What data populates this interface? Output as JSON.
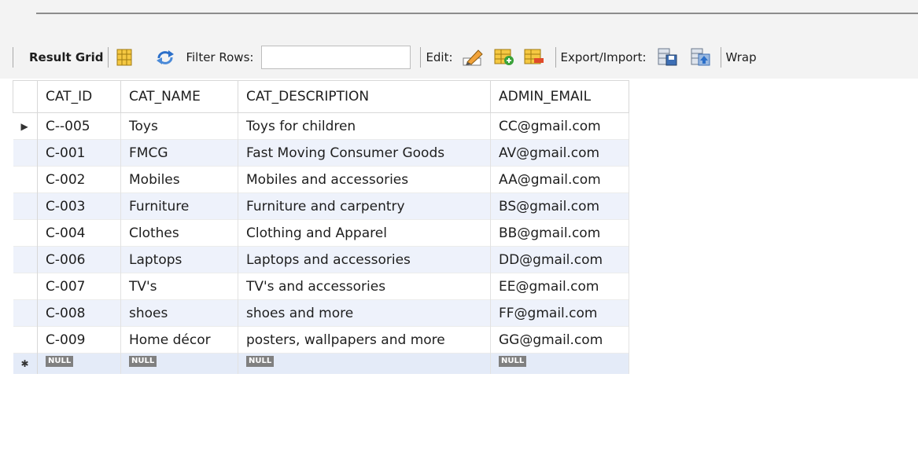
{
  "toolbar": {
    "result_grid_label": "Result Grid",
    "filter_label": "Filter Rows:",
    "filter_value": "",
    "edit_label": "Edit:",
    "export_label": "Export/Import:",
    "wrap_label": "Wrap"
  },
  "grid": {
    "columns": [
      "CAT_ID",
      "CAT_NAME",
      "CAT_DESCRIPTION",
      "ADMIN_EMAIL"
    ],
    "rows": [
      [
        "C--005",
        "Toys",
        "Toys for children",
        "CC@gmail.com"
      ],
      [
        "C-001",
        "FMCG",
        "Fast Moving Consumer Goods",
        "AV@gmail.com"
      ],
      [
        "C-002",
        "Mobiles",
        "Mobiles and accessories",
        "AA@gmail.com"
      ],
      [
        "C-003",
        "Furniture",
        "Furniture and carpentry",
        "BS@gmail.com"
      ],
      [
        "C-004",
        "Clothes",
        "Clothing and Apparel",
        "BB@gmail.com"
      ],
      [
        "C-006",
        "Laptops",
        "Laptops and accessories",
        "DD@gmail.com"
      ],
      [
        "C-007",
        "TV's",
        "TV's and accessories",
        "EE@gmail.com"
      ],
      [
        "C-008",
        "shoes",
        "shoes and more",
        "FF@gmail.com"
      ],
      [
        "C-009",
        "Home décor",
        "posters, wallpapers and more",
        "GG@gmail.com"
      ]
    ],
    "null_label": "NULL",
    "current_row_marker": "▶",
    "new_row_marker": "✱"
  },
  "icons": {
    "form-editor": "form-editor-icon",
    "refresh": "refresh-icon",
    "edit-cell": "edit-cell-icon",
    "add-row": "add-row-icon",
    "delete-row": "delete-row-icon",
    "export": "export-icon",
    "import": "import-icon"
  },
  "colors": {
    "alt_row": "#eef2fb",
    "null_badge": "#808080",
    "refresh_blue": "#2b6fc9"
  }
}
